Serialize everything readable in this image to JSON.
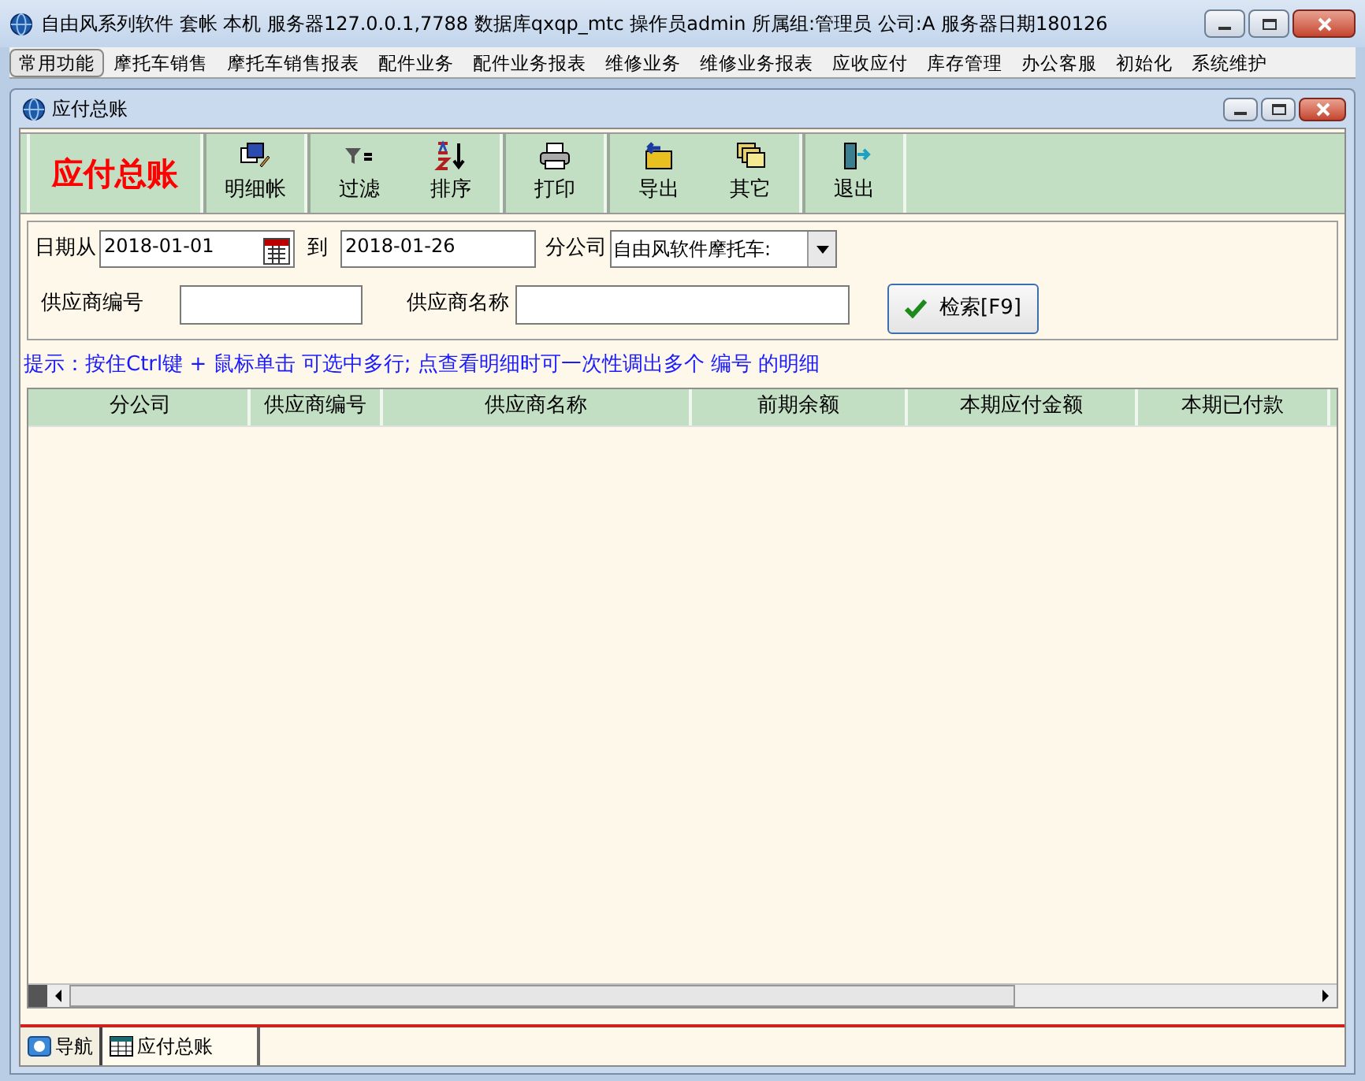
{
  "window": {
    "title": "自由风系列软件  套帐 本机  服务器127.0.0.1,7788  数据库qxqp_mtc  操作员admin  所属组:管理员  公司:A  服务器日期180126"
  },
  "menu": [
    {
      "label": "常用功能",
      "selected": true
    },
    {
      "label": "摩托车销售",
      "selected": false
    },
    {
      "label": "摩托车销售报表",
      "selected": false
    },
    {
      "label": "配件业务",
      "selected": false
    },
    {
      "label": "配件业务报表",
      "selected": false
    },
    {
      "label": "维修业务",
      "selected": false
    },
    {
      "label": "维修业务报表",
      "selected": false
    },
    {
      "label": "应收应付",
      "selected": false
    },
    {
      "label": "库存管理",
      "selected": false
    },
    {
      "label": "办公客服",
      "selected": false
    },
    {
      "label": "初始化",
      "selected": false
    },
    {
      "label": "系统维护",
      "selected": false
    }
  ],
  "child_window": {
    "title": "应付总账"
  },
  "toolbar": {
    "heading": "应付总账",
    "groups": [
      [
        {
          "label": "明细帐",
          "kind": "detail"
        }
      ],
      [
        {
          "label": "过滤",
          "kind": "filter"
        },
        {
          "label": "排序",
          "kind": "sort"
        }
      ],
      [
        {
          "label": "打印",
          "kind": "print"
        }
      ],
      [
        {
          "label": "导出",
          "kind": "export"
        },
        {
          "label": "其它",
          "kind": "other"
        }
      ],
      [
        {
          "label": "退出",
          "kind": "exit"
        }
      ]
    ]
  },
  "filters": {
    "date_from_label": "日期从",
    "date_from": "2018-01-01",
    "to_label": "到",
    "date_to": "2018-01-26",
    "branch_label": "分公司",
    "branch": "自由风软件摩托车:",
    "supplier_code_label": "供应商编号",
    "supplier_name_label": "供应商名称",
    "search_button": "检索[F9]"
  },
  "hint": "提示：按住Ctrl键 + 鼠标单击 可选中多行; 点查看明细时可一次性调出多个 编号 的明细",
  "table": {
    "columns": [
      "分公司",
      "供应商编号",
      "供应商名称",
      "前期余额",
      "本期应付金额",
      "本期已付款"
    ]
  },
  "tabs": [
    {
      "label": "导航",
      "selected": false,
      "kind": "nav"
    },
    {
      "label": "应付总账",
      "selected": true,
      "kind": "table"
    }
  ]
}
